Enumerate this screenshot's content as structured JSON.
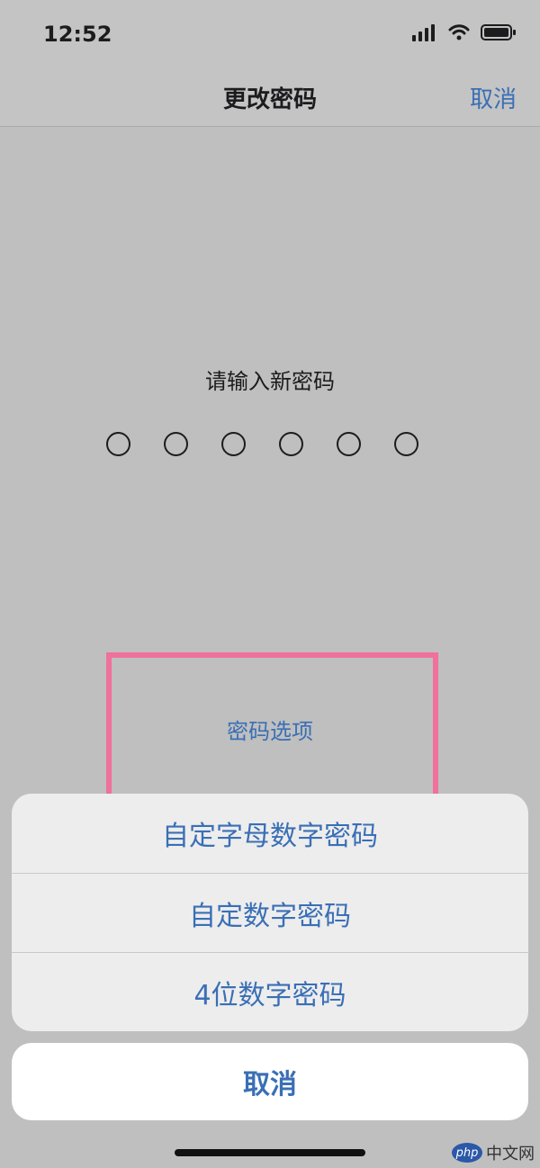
{
  "status_bar": {
    "time": "12:52",
    "icons": [
      "cellular-signal-icon",
      "wifi-icon",
      "battery-icon"
    ]
  },
  "nav": {
    "title": "更改密码",
    "cancel_label": "取消"
  },
  "passcode": {
    "prompt": "请输入新密码",
    "digits_total": 6,
    "digits_entered": 0
  },
  "options_link": {
    "label": "密码选项"
  },
  "action_sheet": {
    "items": [
      {
        "label": "自定字母数字密码"
      },
      {
        "label": "自定数字密码"
      },
      {
        "label": "4位数字密码"
      }
    ],
    "cancel_label": "取消"
  },
  "watermark": {
    "logo_text": "php",
    "text": "中文网"
  },
  "colors": {
    "accent": "#3a6fb5",
    "highlight": "#f0719b",
    "background": "#bfbfbf"
  }
}
